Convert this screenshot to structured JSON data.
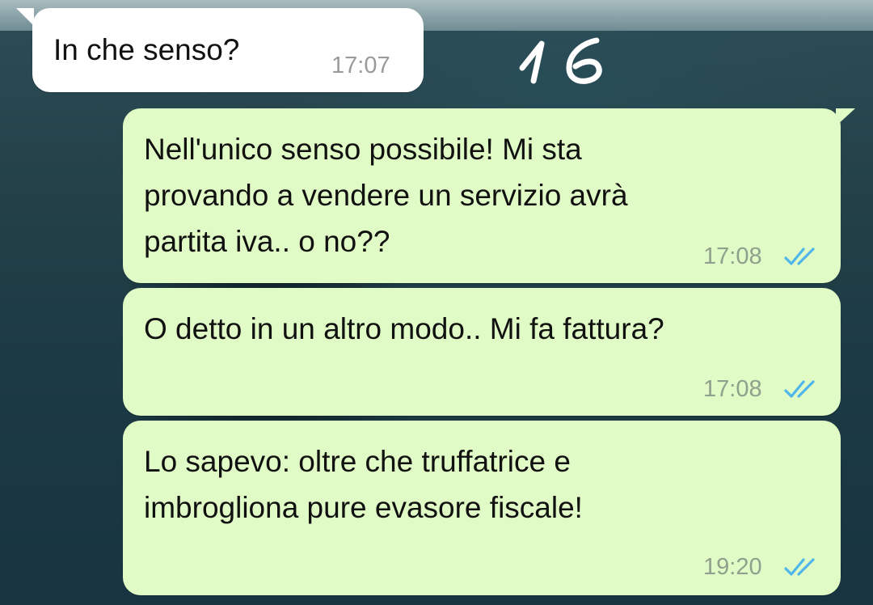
{
  "chat": {
    "messages": [
      {
        "direction": "incoming",
        "text": "In che senso?",
        "time": "17:07"
      },
      {
        "direction": "outgoing",
        "lines": [
          "Nell'unico senso possibile! Mi sta",
          "provando a vendere un servizio avrà",
          "partita iva.. o no??"
        ],
        "time": "17:08",
        "status": "read"
      },
      {
        "direction": "outgoing",
        "lines": [
          "O detto in un altro modo.. Mi fa fattura?"
        ],
        "time": "17:08",
        "status": "read"
      },
      {
        "direction": "outgoing",
        "lines": [
          "Lo sapevo: oltre che truffatrice e",
          "imbrogliona pure evasore fiscale!"
        ],
        "time": "19:20",
        "status": "read"
      }
    ]
  },
  "overlay": {
    "handwritten_number": "16"
  },
  "colors": {
    "incoming_bubble": "#ffffff",
    "outgoing_bubble": "#e1fbc6",
    "read_ticks": "#4fb6ec",
    "background": "#1f3c45"
  },
  "icons": {
    "read_receipt": "double-check-icon"
  }
}
